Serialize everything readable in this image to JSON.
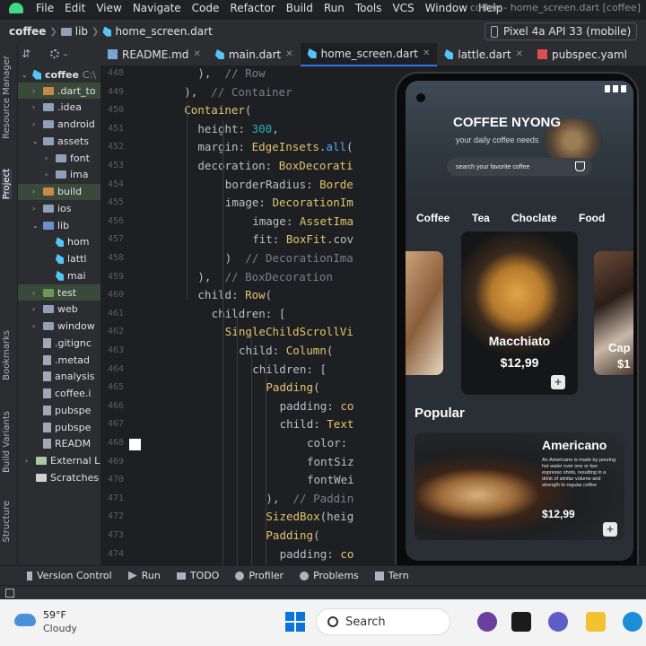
{
  "menu": {
    "items": [
      "File",
      "Edit",
      "View",
      "Navigate",
      "Code",
      "Refactor",
      "Build",
      "Run",
      "Tools",
      "VCS",
      "Window",
      "Help"
    ],
    "project_title": "coffee - home_screen.dart [coffee]"
  },
  "nav": {
    "breadcrumb": [
      "coffee",
      "lib",
      "home_screen.dart"
    ],
    "device": "Pixel 4a API 33 (mobile)"
  },
  "left_strip": {
    "labels": [
      "Resource Manager",
      "Project",
      "Bookmarks",
      "Build Variants",
      "Structure"
    ]
  },
  "project_panel": {
    "root": "coffee",
    "root_path": "C:\\",
    "tree": [
      {
        "label": ".dart_to",
        "type": "folder-orange"
      },
      {
        "label": ".idea",
        "type": "folder"
      },
      {
        "label": "android",
        "type": "folder"
      },
      {
        "label": "assets",
        "type": "folder"
      },
      {
        "label": "font",
        "type": "folder"
      },
      {
        "label": "ima",
        "type": "folder"
      },
      {
        "label": "build",
        "type": "folder-orange"
      },
      {
        "label": "ios",
        "type": "folder"
      },
      {
        "label": "lib",
        "type": "folder-blue"
      },
      {
        "label": "hom",
        "type": "dart"
      },
      {
        "label": "lattl",
        "type": "dart"
      },
      {
        "label": "mai",
        "type": "dart"
      },
      {
        "label": "test",
        "type": "folder-green"
      },
      {
        "label": "web",
        "type": "folder"
      },
      {
        "label": "window",
        "type": "folder"
      },
      {
        "label": ".gitignc",
        "type": "file"
      },
      {
        "label": ".metad",
        "type": "file"
      },
      {
        "label": "analysis",
        "type": "file"
      },
      {
        "label": "coffee.i",
        "type": "file"
      },
      {
        "label": "pubspe",
        "type": "file"
      },
      {
        "label": "pubspe",
        "type": "file"
      },
      {
        "label": "READM",
        "type": "file"
      },
      {
        "label": "External Lil",
        "type": "lib"
      },
      {
        "label": "Scratches a",
        "type": "scratch"
      }
    ]
  },
  "tabs": [
    {
      "label": "README.md",
      "icon": "markdown-icon",
      "active": false
    },
    {
      "label": "main.dart",
      "icon": "dart-icon",
      "active": false
    },
    {
      "label": "home_screen.dart",
      "icon": "dart-icon",
      "active": true
    },
    {
      "label": "lattle.dart",
      "icon": "dart-icon",
      "active": false
    },
    {
      "label": "pubspec.yaml",
      "icon": "yaml-icon",
      "active": false
    }
  ],
  "editor": {
    "line_numbers": [
      "448",
      "449",
      "450",
      "451",
      "452",
      "453",
      "454",
      "455",
      "456",
      "457",
      "458",
      "459",
      "460",
      "461",
      "462",
      "463",
      "464",
      "465",
      "466",
      "467",
      "468",
      "469",
      "470",
      "471",
      "472",
      "473",
      "474"
    ],
    "lines": [
      {
        "indent": 9,
        "parts": [
          [
            "p",
            "),"
          ],
          [
            "c",
            "  // Row"
          ]
        ]
      },
      {
        "indent": 7,
        "parts": [
          [
            "p",
            "),"
          ],
          [
            "c",
            "  // Container"
          ]
        ]
      },
      {
        "indent": 7,
        "parts": [
          [
            "k",
            "Container"
          ],
          [
            "p",
            "("
          ]
        ]
      },
      {
        "indent": 9,
        "parts": [
          [
            "p",
            "height: "
          ],
          [
            "n",
            "300"
          ],
          [
            "p",
            ","
          ]
        ]
      },
      {
        "indent": 9,
        "parts": [
          [
            "p",
            "margin: "
          ],
          [
            "k",
            "EdgeInsets"
          ],
          [
            "p",
            "."
          ],
          [
            "f",
            "all"
          ],
          [
            "p",
            "("
          ]
        ]
      },
      {
        "indent": 9,
        "parts": [
          [
            "p",
            "decoration: "
          ],
          [
            "k",
            "BoxDecorati"
          ]
        ]
      },
      {
        "indent": 13,
        "parts": [
          [
            "p",
            "borderRadius: "
          ],
          [
            "k",
            "Borde"
          ]
        ]
      },
      {
        "indent": 13,
        "parts": [
          [
            "p",
            "image: "
          ],
          [
            "k",
            "DecorationIm"
          ]
        ]
      },
      {
        "indent": 17,
        "parts": [
          [
            "p",
            "image: "
          ],
          [
            "k",
            "AssetIma"
          ]
        ]
      },
      {
        "indent": 17,
        "parts": [
          [
            "p",
            "fit: "
          ],
          [
            "k",
            "BoxFit"
          ],
          [
            "p",
            ".cov"
          ]
        ]
      },
      {
        "indent": 13,
        "parts": [
          [
            "p",
            ")"
          ],
          [
            "c",
            "  // DecorationIma"
          ]
        ]
      },
      {
        "indent": 9,
        "parts": [
          [
            "p",
            "),"
          ],
          [
            "c",
            "  // BoxDecoration"
          ]
        ]
      },
      {
        "indent": 9,
        "parts": [
          [
            "p",
            "child: "
          ],
          [
            "k",
            "Row"
          ],
          [
            "p",
            "("
          ]
        ]
      },
      {
        "indent": 11,
        "parts": [
          [
            "p",
            "children: ["
          ]
        ]
      },
      {
        "indent": 13,
        "parts": [
          [
            "k",
            "SingleChildScrollVi"
          ]
        ]
      },
      {
        "indent": 15,
        "parts": [
          [
            "p",
            "child: "
          ],
          [
            "k",
            "Column"
          ],
          [
            "p",
            "("
          ]
        ]
      },
      {
        "indent": 17,
        "parts": [
          [
            "p",
            "children: ["
          ]
        ]
      },
      {
        "indent": 19,
        "parts": [
          [
            "k",
            "Padding"
          ],
          [
            "p",
            "("
          ]
        ]
      },
      {
        "indent": 21,
        "parts": [
          [
            "p",
            "padding: "
          ],
          [
            "k",
            "co"
          ]
        ]
      },
      {
        "indent": 21,
        "parts": [
          [
            "p",
            "child: "
          ],
          [
            "k",
            "Text"
          ]
        ]
      },
      {
        "indent": 25,
        "parts": [
          [
            "p",
            "color: "
          ]
        ]
      },
      {
        "indent": 25,
        "parts": [
          [
            "p",
            "fontSiz"
          ]
        ]
      },
      {
        "indent": 25,
        "parts": [
          [
            "p",
            "fontWei"
          ]
        ]
      },
      {
        "indent": 19,
        "parts": [
          [
            "p",
            "),"
          ],
          [
            "c",
            "  // Paddin"
          ]
        ]
      },
      {
        "indent": 19,
        "parts": [
          [
            "k",
            "SizedBox"
          ],
          [
            "p",
            "(heig"
          ]
        ]
      },
      {
        "indent": 19,
        "parts": [
          [
            "k",
            "Padding"
          ],
          [
            "p",
            "("
          ]
        ]
      },
      {
        "indent": 21,
        "parts": [
          [
            "p",
            "padding: "
          ],
          [
            "k",
            "co"
          ]
        ]
      }
    ]
  },
  "bottom_bar": {
    "items": [
      {
        "label": "Version Control",
        "icon": "branch-icon"
      },
      {
        "label": "Run",
        "icon": "play-icon"
      },
      {
        "label": "TODO",
        "icon": "list-icon"
      },
      {
        "label": "Profiler",
        "icon": "gauge-icon"
      },
      {
        "label": "Problems",
        "icon": "warning-icon"
      },
      {
        "label": "Tern",
        "icon": "terminal-icon"
      }
    ]
  },
  "taskbar": {
    "temperature": "59°F",
    "condition": "Cloudy",
    "search_label": "Search"
  },
  "phone_app": {
    "title": "COFFEE NYONG",
    "subtitle": "your daily coffee needs",
    "search_placeholder": "search your favorite coffee",
    "categories": [
      "Coffee",
      "Tea",
      "Choclate",
      "Food"
    ],
    "featured": {
      "name": "Macchiato",
      "price": "$12,99"
    },
    "side_card": {
      "name": "Cap",
      "price": "$1"
    },
    "popular_heading": "Popular",
    "popular": {
      "name": "Americano",
      "description": "An Americano is made by pouring hot water over one or two espresso shots, resulting in a drink of similar volume and strength to regular coffee",
      "price": "$12,99"
    }
  },
  "colors": {
    "accent": "#3574f0",
    "ide_bg": "#1e1f22",
    "panel_bg": "#2b2d30",
    "keyword": "#cf8e6d",
    "type": "#e0c46c",
    "number": "#2aacb8",
    "comment": "#7a7e85"
  }
}
